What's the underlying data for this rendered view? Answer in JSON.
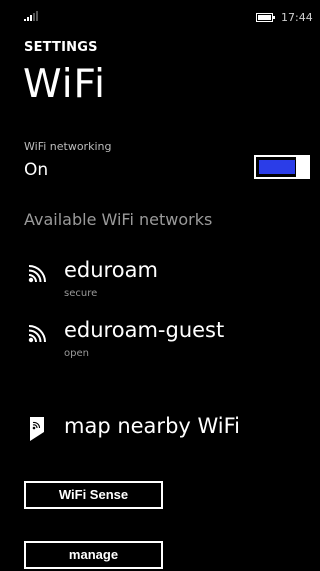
{
  "status_bar": {
    "time": "17:44",
    "signal_icon": "signal-bars-icon",
    "battery_icon": "battery-icon"
  },
  "header": {
    "section": "SETTINGS",
    "title": "WiFi"
  },
  "wifi_toggle": {
    "caption": "WiFi networking",
    "state": "On",
    "enabled": true,
    "accent_color": "#2b3de8"
  },
  "networks": {
    "header": "Available WiFi networks",
    "items": [
      {
        "name": "eduroam",
        "status": "secure",
        "icon": "wifi-signal-icon"
      },
      {
        "name": "eduroam-guest",
        "status": "open",
        "icon": "wifi-signal-icon"
      }
    ]
  },
  "map_link": {
    "label": "map nearby WiFi",
    "icon": "map-wifi-icon"
  },
  "buttons": {
    "wifi_sense": "WiFi Sense",
    "manage": "manage"
  }
}
